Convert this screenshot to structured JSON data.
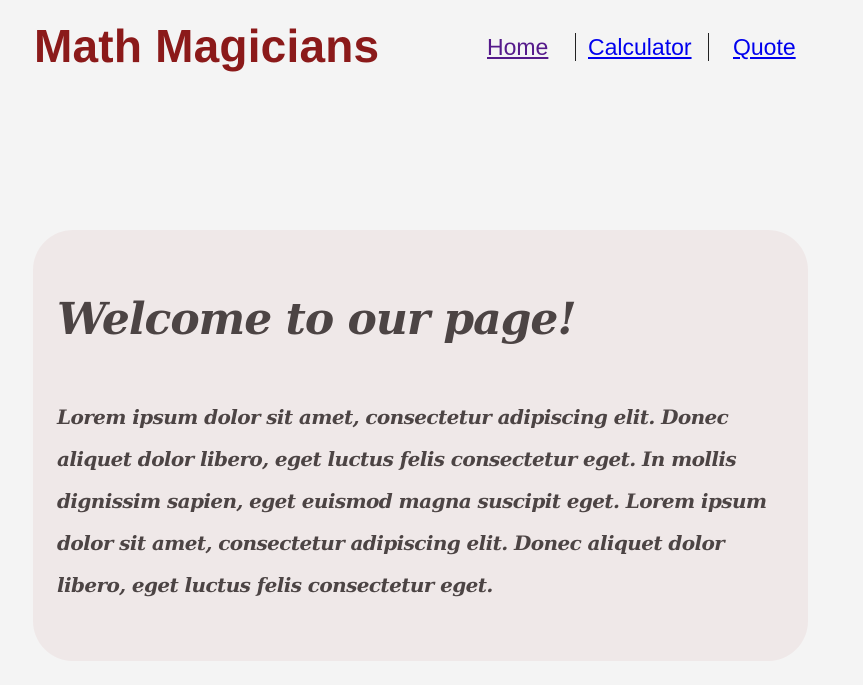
{
  "header": {
    "brand": "Math Magicians",
    "nav": [
      {
        "label": "Home"
      },
      {
        "label": "Calculator"
      },
      {
        "label": "Quote"
      }
    ]
  },
  "main": {
    "heading": "Welcome to our page!",
    "paragraph": "Lorem ipsum dolor sit amet, consectetur adipiscing elit. Donec aliquet dolor libero, eget luctus felis consectetur eget. In mollis dignissim sapien, eget euismod magna suscipit eget. Lorem ipsum dolor sit amet, consectetur adipiscing elit. Donec aliquet dolor libero, eget luctus felis consectetur eget."
  },
  "colors": {
    "brand": "#8b1a1a",
    "link": "#0000ee",
    "visited_link": "#551a8b",
    "card_background": "#efe8e8",
    "body_text": "#4c4444",
    "page_background": "#f4f4f4"
  }
}
